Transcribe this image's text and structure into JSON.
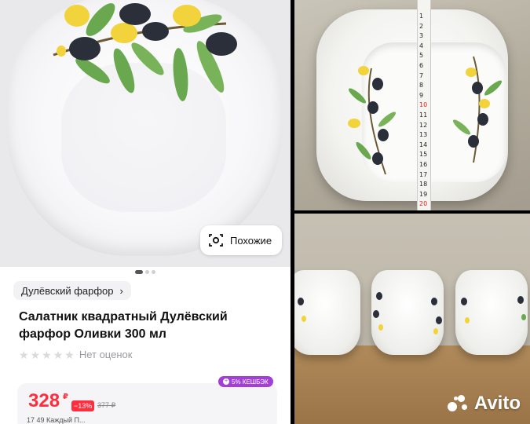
{
  "product": {
    "similar_label": "Похожие",
    "brand": "Дулёвский фарфор",
    "title": "Салатник квадратный Дулёвский фарфор Оливки 300 мл",
    "rating_text": "Нет оценок",
    "cashback": "5% КЕШБЭК",
    "price": "328",
    "currency": "₽",
    "discount": "−13%",
    "old_price": "377 ₽",
    "bottom_partial": "17   49   Каждый П...",
    "gallery_pages": 3,
    "gallery_active": 1
  },
  "ruler": {
    "numbers": [
      "1",
      "2",
      "3",
      "4",
      "5",
      "6",
      "7",
      "8",
      "9",
      "10",
      "11",
      "12",
      "13",
      "14",
      "15",
      "16",
      "17",
      "18",
      "19",
      "20"
    ]
  },
  "watermark": {
    "text": "Avito"
  },
  "colors": {
    "price": "#ff2d3d",
    "cashback": "#a33fd6",
    "olive_leaf": "#6aa84f",
    "olive_dark": "#2a2f3a",
    "olive_yellow": "#f2d33b"
  }
}
